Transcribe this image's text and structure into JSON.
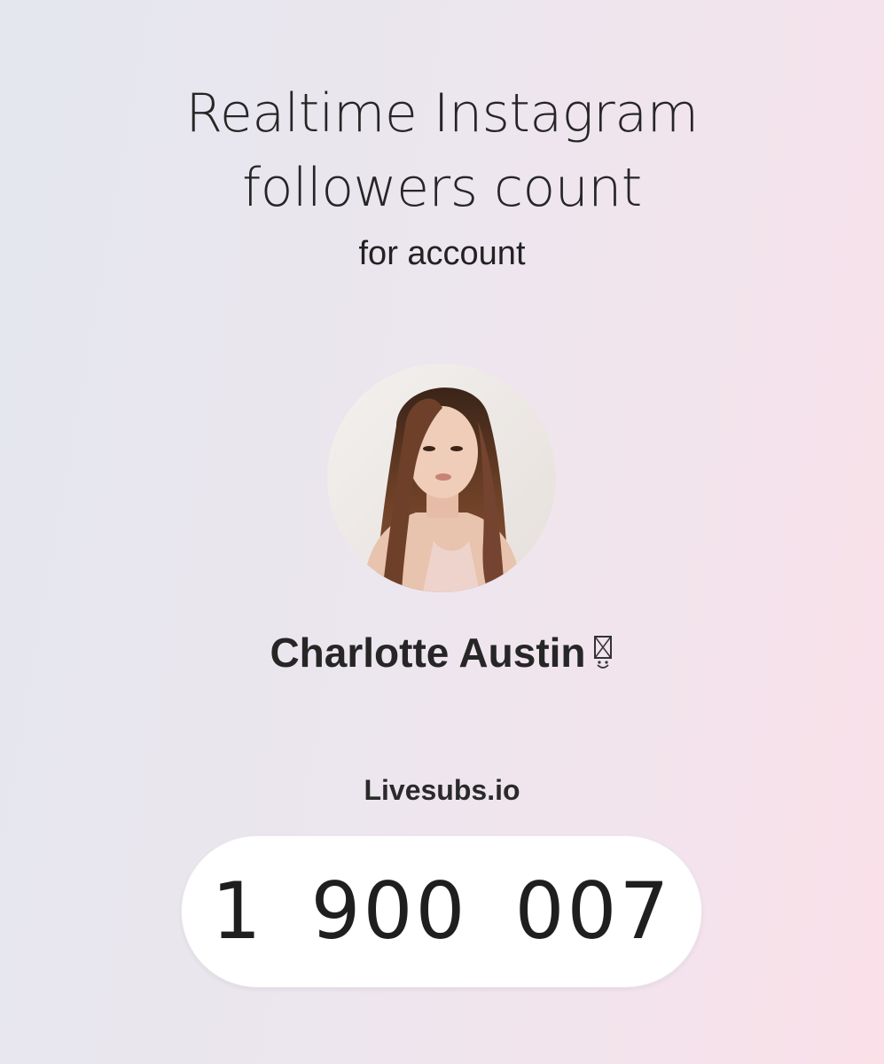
{
  "header": {
    "title_line1": "Realtime Instagram",
    "title_line2": "followers count",
    "subtitle": "for account"
  },
  "account": {
    "avatar_icon": "profile-photo",
    "name": "Charlotte Austin",
    "name_suffix_glyph": "missing-glyph-icon"
  },
  "brand": {
    "label": "Livesubs.io"
  },
  "counter": {
    "value": "1 900 007"
  },
  "colors": {
    "background_left": "#e4e7ee",
    "background_right": "#fbe0e8",
    "counter_bg": "#ffffff",
    "text": "#222222"
  }
}
